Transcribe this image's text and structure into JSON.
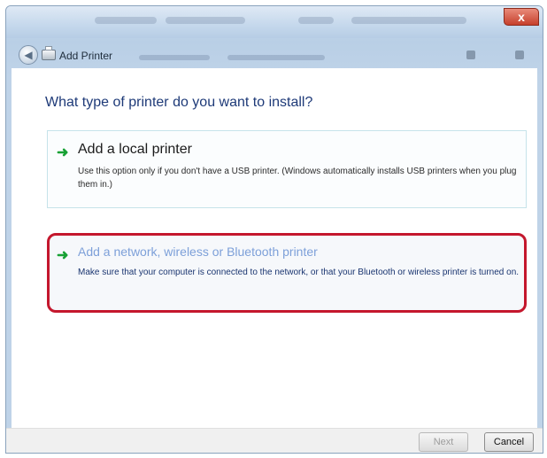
{
  "window": {
    "close_glyph": "x",
    "nav_title": "Add Printer",
    "back_icon": "back-arrow-icon",
    "app_icon": "printer-icon"
  },
  "main": {
    "heading": "What type of printer do you want to install?",
    "options": [
      {
        "title": "Add a local printer",
        "description": "Use this option only if you don't have a USB printer. (Windows automatically installs USB printers when you plug them in.)",
        "icon": "green-arrow-icon"
      },
      {
        "title": "Add a network, wireless or Bluetooth printer",
        "description": "Make sure that your computer is connected to the network, or that your Bluetooth or wireless printer is turned on.",
        "icon": "green-arrow-icon",
        "highlight_color": "#c4172d"
      }
    ]
  },
  "footer": {
    "next_label": "Next",
    "cancel_label": "Cancel"
  },
  "colors": {
    "heading": "#1e3a78",
    "arrow": "#17a134",
    "highlight": "#c4172d"
  }
}
